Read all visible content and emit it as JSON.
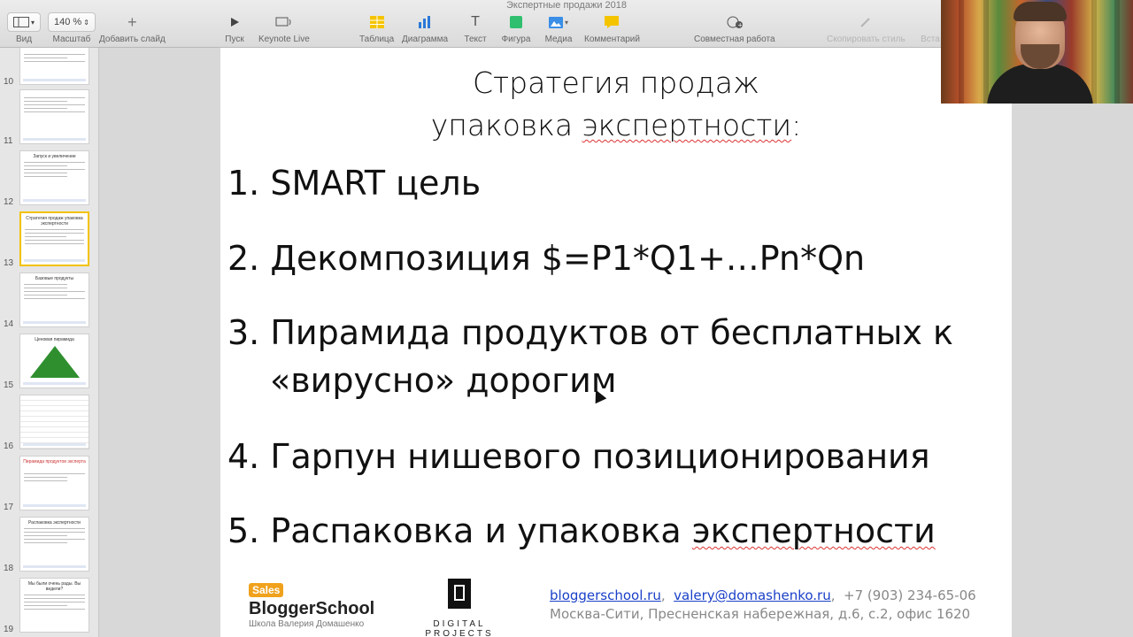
{
  "window": {
    "title": "Экспертные продажи 2018"
  },
  "toolbar": {
    "view": {
      "icon": "sidebar-view-icon",
      "label": "Вид"
    },
    "zoom": {
      "value": "140 %",
      "label": "Масштаб"
    },
    "add_slide": {
      "icon": "plus-icon",
      "label": "Добавить слайд"
    },
    "play": {
      "icon": "play-icon",
      "label": "Пуск"
    },
    "keynote_live": {
      "icon": "keynote-live-icon",
      "label": "Keynote Live"
    },
    "table": {
      "icon": "table-icon",
      "label": "Таблица"
    },
    "chart": {
      "icon": "bar-chart-icon",
      "label": "Диаграмма"
    },
    "text": {
      "icon": "text-icon",
      "glyph": "T",
      "label": "Текст"
    },
    "shape": {
      "icon": "shape-icon",
      "label": "Фигура"
    },
    "media": {
      "icon": "media-icon",
      "label": "Медиа"
    },
    "comment": {
      "icon": "comment-icon",
      "label": "Комментарий"
    },
    "collaborate": {
      "icon": "collaborate-icon",
      "label": "Совместная работа"
    },
    "copy_style": {
      "icon": "eyedropper-icon",
      "label": "Скопировать стиль"
    },
    "paste": {
      "label": "Вста"
    }
  },
  "navigator": {
    "slides": [
      {
        "num": "10",
        "title": ""
      },
      {
        "num": "11",
        "title": ""
      },
      {
        "num": "12",
        "title": "Запуск и увеличение"
      },
      {
        "num": "13",
        "title": "Стратегия продаж упаковка экспертности"
      },
      {
        "num": "14",
        "title": "Базовые продукты"
      },
      {
        "num": "15",
        "title": "Ценовая пирамида"
      },
      {
        "num": "16",
        "title": ""
      },
      {
        "num": "17",
        "title": "Пирамида продуктов эксперта"
      },
      {
        "num": "18",
        "title": "Распаковка экспертности"
      },
      {
        "num": "19",
        "title": "Мы были очень рады. Вы видели?"
      }
    ],
    "selected": "13"
  },
  "slide": {
    "title_line1": "Стратегия продаж",
    "title_line2_pre": "упаковка ",
    "title_line2_word": "экспертности",
    "title_line2_post": ":",
    "items": [
      {
        "text": "1. SMART цель"
      },
      {
        "text": "2. Декомпозиция $=P1*Q1+…Pn*Qn"
      },
      {
        "text": "3. Пирамида продуктов от бесплатных к",
        "cont": "«вирусно» дорогим"
      },
      {
        "text": "4. Гарпун нишевого позиционирования"
      },
      {
        "text_pre": "5. Распаковка и упаковка ",
        "text_word": "экспертности"
      }
    ],
    "footer": {
      "logo_badge": "Sales",
      "logo_name": "BloggerSchool",
      "logo_sub": "Школа Валерия Домашенко",
      "dp_name": "DIGITAL PROJECTS",
      "link_site": "bloggerschool.ru",
      "sep1": ",  ",
      "link_email": "valery@domashenko.ru",
      "sep2": ",  ",
      "phone": "+7 (903) 234-65-06",
      "address": "Москва-Сити, Пресненская набережная, д.6, с.2, офис 1620"
    }
  },
  "colors": {
    "selection": "#f2c200",
    "link": "#1a3fc8",
    "spellcheck": "#dd3333"
  }
}
